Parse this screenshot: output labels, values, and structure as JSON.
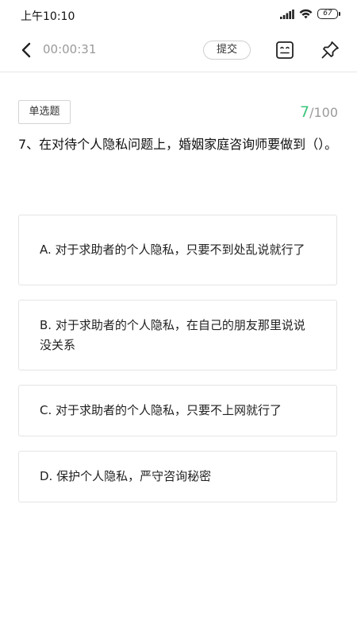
{
  "status_bar": {
    "time": "上午10:10",
    "battery": "67"
  },
  "toolbar": {
    "timer": "00:00:31",
    "submit_label": "提交"
  },
  "question": {
    "type": "单选题",
    "current": "7",
    "total": "/100",
    "text": "7、在对待个人隐私问题上，婚姻家庭咨询师要做到（）。"
  },
  "options": [
    {
      "text": "A. 对于求助者的个人隐私，只要不到处乱说就行了"
    },
    {
      "text": "B. 对于求助者的个人隐私，在自己的朋友那里说说没关系"
    },
    {
      "text": "C. 对于求助者的个人隐私，只要不上网就行了"
    },
    {
      "text": "D. 保护个人隐私，严守咨询秘密"
    }
  ],
  "colors": {
    "accent_green": "#3cc47c",
    "muted_text": "#9a9a9a",
    "border": "#e4e4e4"
  },
  "icons": {
    "back": "chevron-left-icon",
    "answer_card": "answer-card-icon",
    "pin": "pin-icon",
    "signal": "signal-icon",
    "wifi": "wifi-icon",
    "battery": "battery-icon"
  }
}
